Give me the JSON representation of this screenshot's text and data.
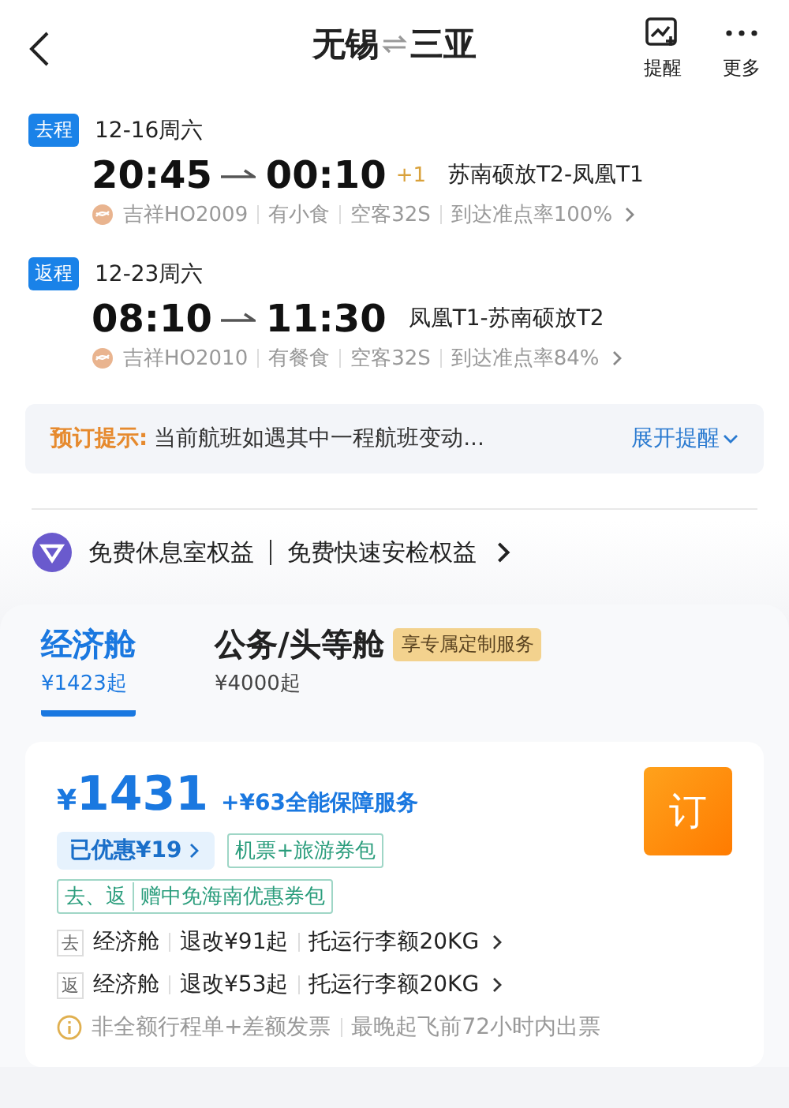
{
  "header": {
    "from": "无锡",
    "to": "三亚",
    "actions": [
      {
        "kind": "alert",
        "label": "提醒"
      },
      {
        "kind": "more",
        "label": "更多"
      }
    ]
  },
  "legs": [
    {
      "tag": "去程",
      "date": "12-16周六",
      "depart": "20:45",
      "arrive": "00:10",
      "day_offset": "+1",
      "route": "苏南硕放T2-凤凰T1",
      "details": [
        "吉祥HO2009",
        "有小食",
        "空客32S",
        "到达准点率100%"
      ]
    },
    {
      "tag": "返程",
      "date": "12-23周六",
      "depart": "08:10",
      "arrive": "11:30",
      "route": "凤凰T1-苏南硕放T2",
      "details": [
        "吉祥HO2010",
        "有餐食",
        "空客32S",
        "到达准点率84%"
      ]
    }
  ],
  "notice": {
    "label": "预订提示:",
    "text": "当前航班如遇其中一程航班变动...",
    "action": "展开提醒"
  },
  "benefits": [
    "免费休息室权益",
    "免费快速安检权益"
  ],
  "cabins": [
    {
      "name": "经济舱",
      "price": "¥1423起",
      "selected": true
    },
    {
      "name": "公务/头等舱",
      "price": "¥4000起",
      "selected": false,
      "badge": "享专属定制服务"
    }
  ],
  "offer": {
    "currency": "¥",
    "price": "1431",
    "addon": "+¥63全能保障服务",
    "discount": "已优惠¥19",
    "package": "机票+旅游券包",
    "gift_tag": "去、返",
    "gift": "赠中免海南优惠券包",
    "book": "订",
    "segments": [
      {
        "tag": "去",
        "items": [
          "经济舱",
          "退改¥91起",
          "托运行李额20KG"
        ]
      },
      {
        "tag": "返",
        "items": [
          "经济舱",
          "退改¥53起",
          "托运行李额20KG"
        ]
      }
    ],
    "footnote": [
      "非全额行程单+差额发票",
      "最晚起飞前72小时内出票"
    ]
  }
}
